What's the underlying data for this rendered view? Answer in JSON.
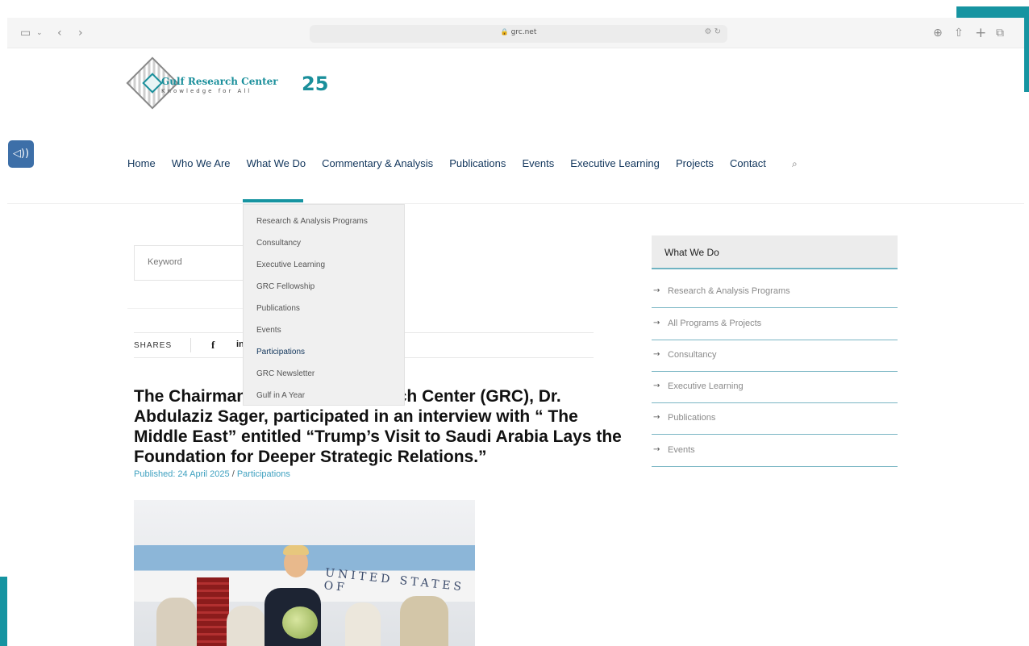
{
  "browser": {
    "url": "grc.net",
    "url_right_glyph": "⚙ ↻",
    "icons": [
      "sidebar-icon",
      "chevron-down-icon",
      "back-icon",
      "forward-icon",
      "download-icon",
      "share-icon",
      "new-tab-icon",
      "tabs-icon"
    ]
  },
  "logo": {
    "name": "Gulf Research Center",
    "tagline": "Knowledge for All",
    "anniversary": "25"
  },
  "nav": {
    "items": [
      "Home",
      "Who We Are",
      "What We Do",
      "Commentary & Analysis",
      "Publications",
      "Events",
      "Executive Learning",
      "Projects",
      "Contact"
    ],
    "active": "What We Do"
  },
  "dropdown": {
    "items": [
      "Research & Analysis Programs",
      "Consultancy",
      "Executive Learning",
      "GRC Fellowship",
      "Publications",
      "Events",
      "Participations",
      "GRC Newsletter",
      "Gulf in A Year"
    ]
  },
  "search": {
    "placeholder": "Keyword"
  },
  "shares": {
    "label": "SHARES",
    "facebook": "f",
    "linkedin": "in"
  },
  "article": {
    "headline": "The Chairman of the Gulf Research Center (GRC), Dr. Abdulaziz Sager, participated in an interview with “ The Middle East” entitled “Trump’s Visit to Saudi Arabia Lays the Foundation for Deeper Strategic Relations.”",
    "published": "Published: 24 April 2025",
    "separator": "/",
    "category": "Participations",
    "photo_plane_text": "UNITED STATES OF"
  },
  "sidebar": {
    "title": "What We Do",
    "items": [
      "Research & Analysis Programs",
      "All Programs & Projects",
      "Consultancy",
      "Executive Learning",
      "Publications",
      "Events"
    ],
    "arrow": "→"
  },
  "colors": {
    "accent": "#1694a1",
    "nav_text": "#12365c",
    "link": "#3fa1c0"
  }
}
